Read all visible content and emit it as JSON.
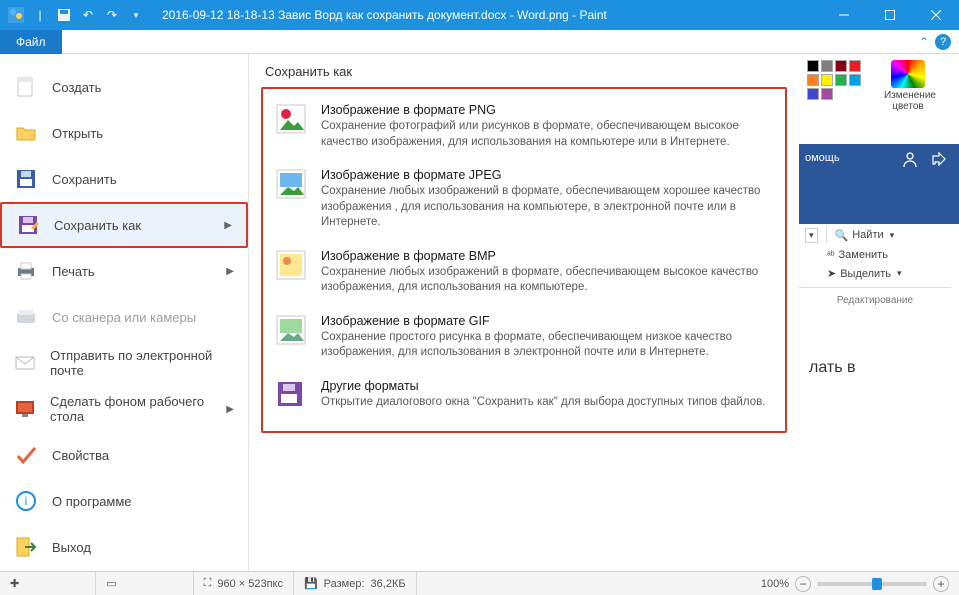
{
  "titlebar": {
    "title": "2016-09-12 18-18-13 Завис Ворд как сохранить документ.docx - Word.png - Paint"
  },
  "file_tab": "Файл",
  "menu": {
    "create": "Создать",
    "open": "Открыть",
    "save": "Сохранить",
    "save_as": "Сохранить как",
    "print": "Печать",
    "scanner": "Со сканера или камеры",
    "email": "Отправить по электронной почте",
    "wallpaper": "Сделать фоном рабочего стола",
    "properties": "Свойства",
    "about": "О программе",
    "exit": "Выход"
  },
  "submenu": {
    "title": "Сохранить как",
    "png": {
      "label": "Изображение в формате PNG",
      "desc": "Сохранение фотографий или рисунков в формате, обеспечивающем высокое качество изображения, для использования на компьютере или в Интернете."
    },
    "jpeg": {
      "label": "Изображение в формате JPEG",
      "desc": "Сохранение любых изображений в формате, обеспечивающем хорошее качество изображения , для использования на компьютере, в электронной почте или в Интернете."
    },
    "bmp": {
      "label": "Изображение в формате BMP",
      "desc": "Сохранение любых изображений в формате, обеспечивающем высокое качество изображения, для использования на компьютере."
    },
    "gif": {
      "label": "Изображение в формате GIF",
      "desc": "Сохранение простого рисунка в формате, обеспечивающем низкое качество изображения, для использования в электронной почте или в Интернете."
    },
    "other": {
      "label": "Другие форматы",
      "desc": "Открытие диалогового окна \"Сохранить как\" для выбора доступных типов файлов."
    }
  },
  "right": {
    "edit_colors": "Изменение цветов",
    "word_help_fragment": "омощь",
    "find": "Найти",
    "replace": "Заменить",
    "select": "Выделить",
    "editing": "Редактирование",
    "doc_text_fragment": "лать в"
  },
  "statusbar": {
    "dims": "960 × 523пкс",
    "size_label": "Размер:",
    "size_value": "36,2КБ",
    "zoom": "100%"
  },
  "palette_colors": [
    "#000000",
    "#7f7f7f",
    "#880015",
    "#ed1c24",
    "#ff7f27",
    "#fff200",
    "#22b14c",
    "#00a2e8",
    "#3f48cc",
    "#a349a4",
    "#ffffff",
    "#c3c3c3",
    "#b97a57",
    "#ffaec9",
    "#ffc90e",
    "#efe4b0",
    "#b5e61d",
    "#99d9ea",
    "#7092be",
    "#c8bfe7"
  ]
}
